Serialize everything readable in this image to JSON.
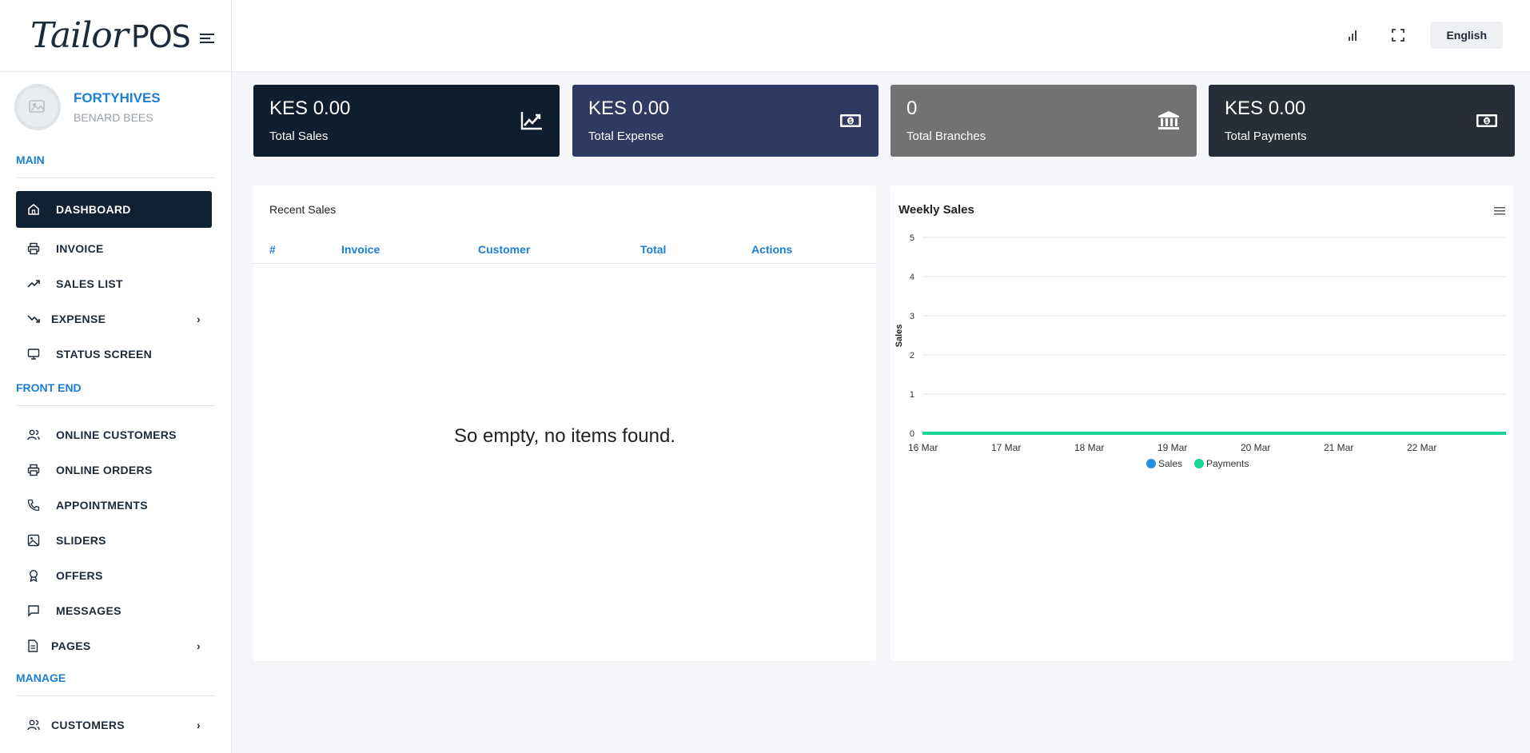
{
  "app": {
    "logo_main": "Tailor",
    "logo_sub": "POS"
  },
  "profile": {
    "company": "FORTYHIVES",
    "user": "BENARD BEES"
  },
  "sidebar": {
    "sections": {
      "main": "MAIN",
      "front_end": "FRONT END",
      "manage": "MANAGE"
    },
    "main_items": [
      {
        "label": "DASHBOARD",
        "icon": "home-icon"
      },
      {
        "label": "INVOICE",
        "icon": "printer-icon"
      },
      {
        "label": "SALES LIST",
        "icon": "trending-up-icon"
      },
      {
        "label": "EXPENSE",
        "icon": "trending-down-icon"
      },
      {
        "label": "STATUS SCREEN",
        "icon": "monitor-icon"
      }
    ],
    "front_items": [
      {
        "label": "ONLINE CUSTOMERS",
        "icon": "users-icon"
      },
      {
        "label": "ONLINE ORDERS",
        "icon": "printer-icon"
      },
      {
        "label": "APPOINTMENTS",
        "icon": "phone-icon"
      },
      {
        "label": "SLIDERS",
        "icon": "image-icon"
      },
      {
        "label": "OFFERS",
        "icon": "award-icon"
      },
      {
        "label": "MESSAGES",
        "icon": "message-icon"
      },
      {
        "label": "PAGES",
        "icon": "file-icon"
      }
    ],
    "manage_items": [
      {
        "label": "CUSTOMERS",
        "icon": "users-icon"
      }
    ]
  },
  "topbar": {
    "language": "English"
  },
  "cards": [
    {
      "value": "KES 0.00",
      "label": "Total Sales",
      "color": "#0f1e2e",
      "icon": "chart-line-icon"
    },
    {
      "value": "KES 0.00",
      "label": "Total Expense",
      "color": "#2f3a63",
      "icon": "money-bill-icon"
    },
    {
      "value": "0",
      "label": "Total Branches",
      "color": "#727272",
      "icon": "bank-icon"
    },
    {
      "value": "KES 0.00",
      "label": "Total Payments",
      "color": "#282d3a",
      "icon": "money-bill-icon"
    }
  ],
  "recent_sales": {
    "title": "Recent Sales",
    "columns": [
      "#",
      "Invoice",
      "Customer",
      "Total",
      "Actions"
    ],
    "empty_text": "So empty, no items found."
  },
  "weekly": {
    "title": "Weekly Sales"
  },
  "chart_data": {
    "type": "line",
    "title": "Weekly Sales",
    "xlabel": "",
    "ylabel": "Sales",
    "categories": [
      "16 Mar",
      "17 Mar",
      "18 Mar",
      "19 Mar",
      "20 Mar",
      "21 Mar",
      "22 Mar"
    ],
    "yticks": [
      "0",
      "1",
      "2",
      "3",
      "4",
      "5"
    ],
    "ylim": [
      0,
      5
    ],
    "grid": true,
    "legend": "bottom-center",
    "series": [
      {
        "name": "Sales",
        "color": "#1e90e8",
        "values": [
          0,
          0,
          0,
          0,
          0,
          0,
          0
        ]
      },
      {
        "name": "Payments",
        "color": "#1ad598",
        "values": [
          0,
          0,
          0,
          0,
          0,
          0,
          0
        ]
      }
    ]
  }
}
